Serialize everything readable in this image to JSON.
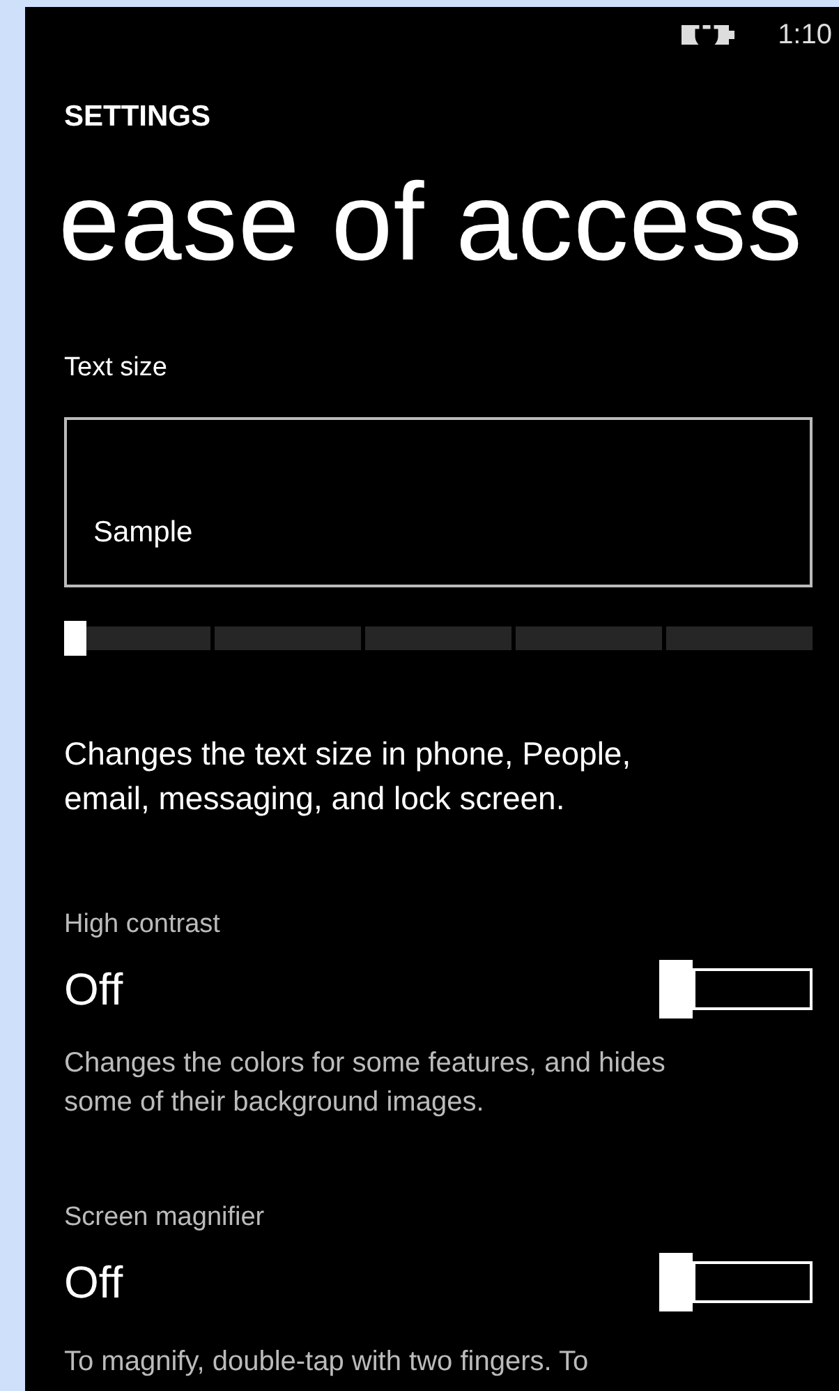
{
  "status_bar": {
    "time": "1:10"
  },
  "header": {
    "section": "SETTINGS",
    "title": "ease of access"
  },
  "text_size": {
    "label": "Text size",
    "sample": "Sample",
    "slider": {
      "level": 0
    },
    "description": "Changes the text size in phone, People, email, messaging, and lock screen."
  },
  "toggles": [
    {
      "label": "High contrast",
      "value": "Off",
      "on": false,
      "description": "Changes the colors for some features, and hides some of their background images."
    },
    {
      "label": "Screen magnifier",
      "value": "Off",
      "on": false,
      "description": "To magnify, double-tap with two fingers.  To"
    }
  ]
}
